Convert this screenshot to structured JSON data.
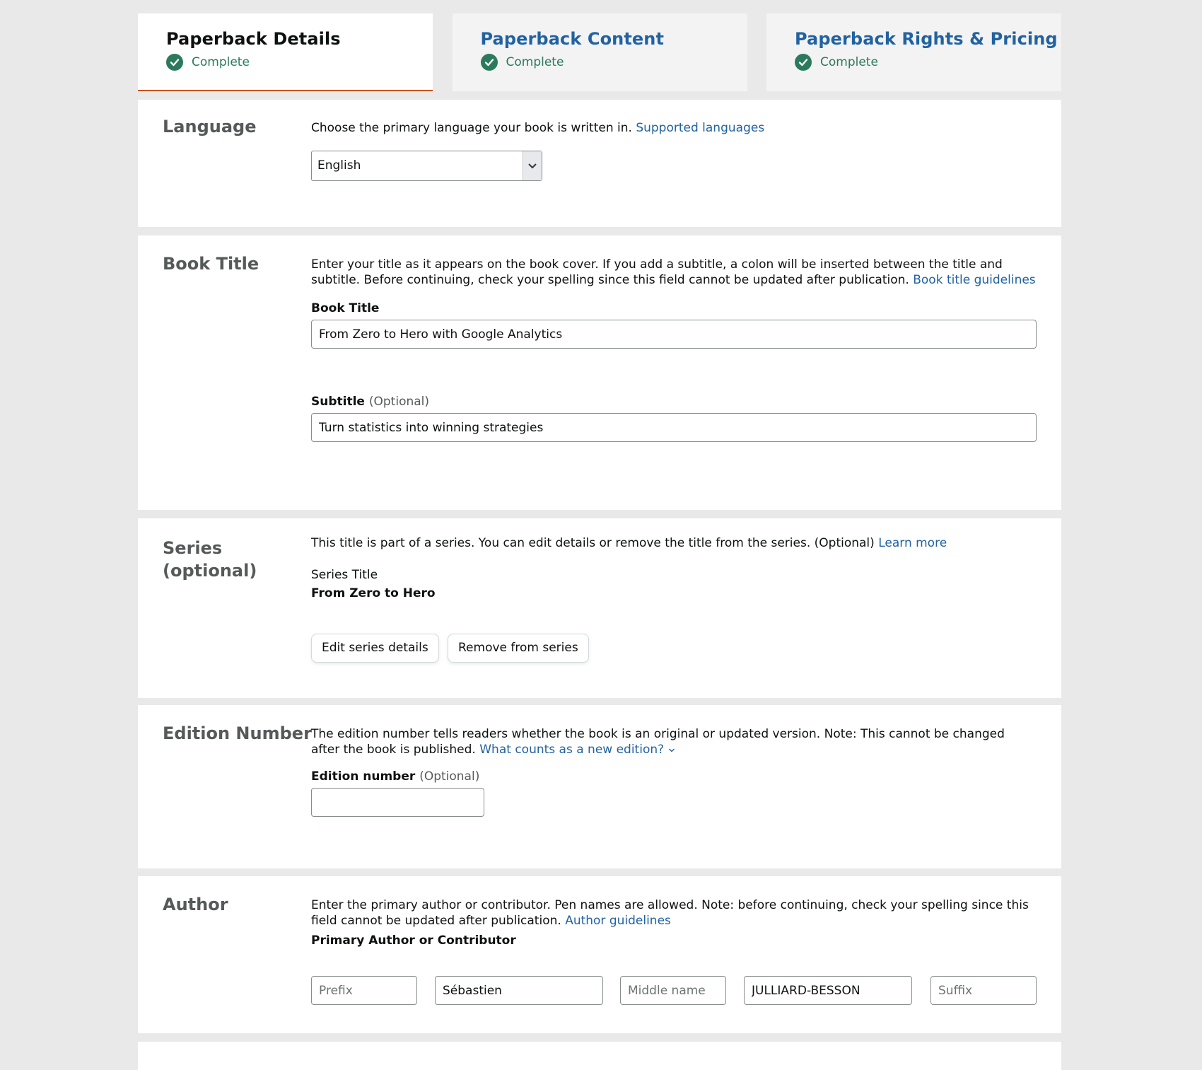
{
  "tabs": [
    {
      "title": "Paperback Details",
      "status": "Complete"
    },
    {
      "title": "Paperback Content",
      "status": "Complete"
    },
    {
      "title": "Paperback Rights & Pricing",
      "status": "Complete"
    }
  ],
  "language": {
    "title": "Language",
    "desc": "Choose the primary language your book is written in.",
    "link": "Supported languages",
    "selected": "English"
  },
  "book_title": {
    "title": "Book Title",
    "desc": "Enter your title as it appears on the book cover. If you add a subtitle, a colon will be inserted between the title and subtitle. Before continuing, check your spelling since this field cannot be updated after publication.",
    "link": "Book title guidelines",
    "title_label": "Book Title",
    "title_value": "From Zero to Hero with Google Analytics",
    "subtitle_label": "Subtitle",
    "subtitle_optional": "(Optional)",
    "subtitle_value": "Turn statistics into winning strategies"
  },
  "series": {
    "title_line1": "Series",
    "title_line2": "(optional)",
    "desc": "This title is part of a series. You can edit details or remove the title from the series. (Optional)",
    "link": "Learn more",
    "series_title_label": "Series Title",
    "series_title_value": "From Zero to Hero",
    "edit_button": "Edit series details",
    "remove_button": "Remove from series"
  },
  "edition": {
    "title": "Edition Number",
    "desc": "The edition number tells readers whether the book is an original or updated version. Note: This cannot be changed after the book is published.",
    "link": "What counts as a new edition?",
    "label": "Edition number",
    "optional": "(Optional)",
    "value": ""
  },
  "author": {
    "title": "Author",
    "desc": "Enter the primary author or contributor. Pen names are allowed. Note: before continuing, check your spelling since this field cannot be updated after publication.",
    "link": "Author guidelines",
    "label": "Primary Author or Contributor",
    "prefix_placeholder": "Prefix",
    "first_name": "Sébastien",
    "middle_placeholder": "Middle name",
    "last_name": "JULLIARD-BESSON",
    "suffix_placeholder": "Suffix"
  },
  "colors": {
    "link": "#2162a1",
    "complete_green": "#2b7a5c",
    "active_tab_underline": "#c45500",
    "page_bg": "#e9e9e9"
  }
}
